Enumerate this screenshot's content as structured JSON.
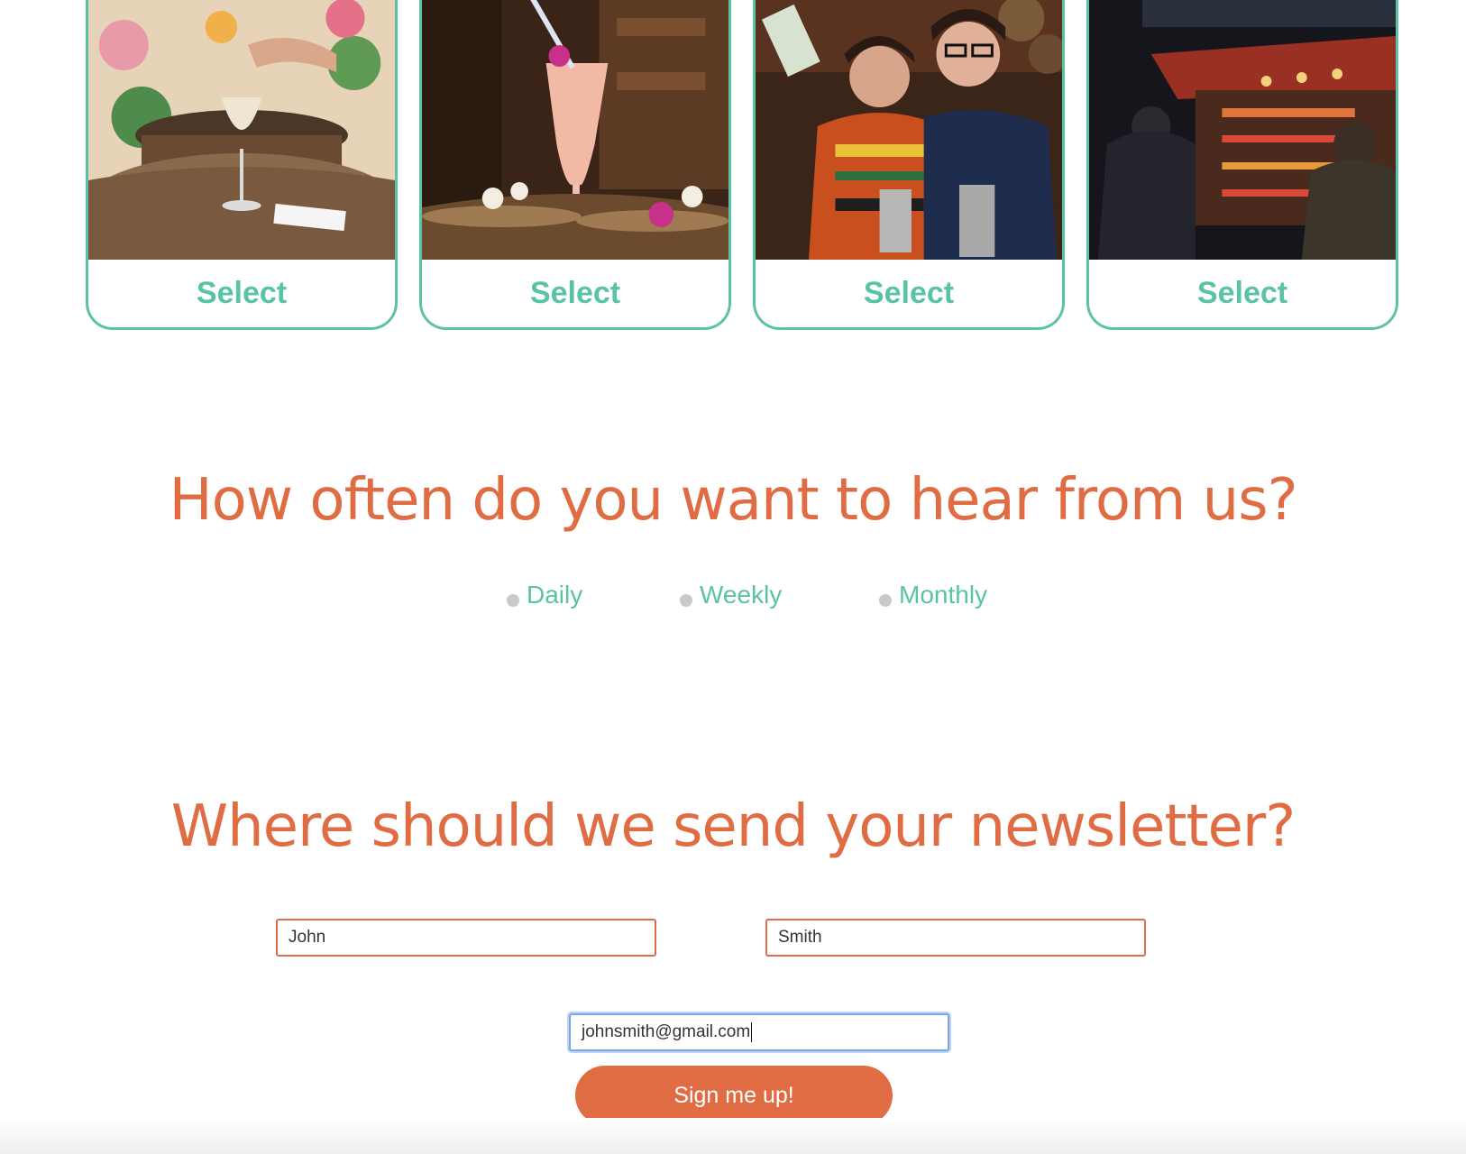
{
  "cards": [
    {
      "select_label": "Select",
      "photo": "cocktail-on-barrel-photo"
    },
    {
      "select_label": "Select",
      "photo": "tiki-drink-photo"
    },
    {
      "select_label": "Select",
      "photo": "bartenders-pouring-photo"
    },
    {
      "select_label": "Select",
      "photo": "busy-bar-street-photo"
    }
  ],
  "frequency": {
    "heading": "How often do you want to hear from us?",
    "options": [
      "Daily",
      "Weekly",
      "Monthly"
    ]
  },
  "newsletter": {
    "heading": "Where should we send your newsletter?",
    "first_name_value": "John",
    "last_name_value": "Smith",
    "email_value": "johnsmith@gmail.com",
    "submit_label": "Sign me up!"
  },
  "colors": {
    "accent_orange": "#e06c44",
    "accent_teal": "#5ac3a5"
  }
}
